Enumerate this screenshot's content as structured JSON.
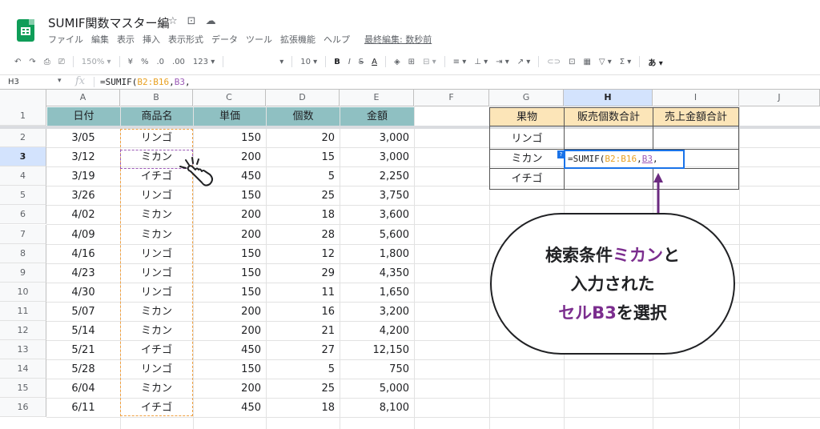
{
  "doc": {
    "title": "SUMIF関数マスター編",
    "icons": [
      "star-icon",
      "folder-move-icon",
      "cloud-status-icon"
    ],
    "menu": [
      "ファイル",
      "編集",
      "表示",
      "挿入",
      "表示形式",
      "データ",
      "ツール",
      "拡張機能",
      "ヘルプ"
    ],
    "last_edit": "最終編集: 数秒前"
  },
  "toolbar": {
    "zoom": "150%",
    "currency": "¥",
    "percent": "%",
    "dec_less": ".0",
    "dec_more": ".00",
    "format": "123",
    "font_size": "10",
    "input_tools": "あ"
  },
  "formula_bar": {
    "name_box": "H3",
    "fx": "fx",
    "formula": "=SUMIF(B2:B16,B3,"
  },
  "columns": [
    "A",
    "B",
    "C",
    "D",
    "E",
    "F",
    "G",
    "H",
    "I",
    "J"
  ],
  "selected_column": "H",
  "selected_row": "3",
  "rows": [
    "1",
    "2",
    "3",
    "4",
    "5",
    "6",
    "7",
    "8",
    "9",
    "10",
    "11",
    "12",
    "13",
    "14",
    "15",
    "16"
  ],
  "table": {
    "headers": [
      "日付",
      "商品名",
      "単価",
      "個数",
      "金額"
    ],
    "data": [
      [
        "3/05",
        "リンゴ",
        "150",
        "20",
        "3,000"
      ],
      [
        "3/12",
        "ミカン",
        "200",
        "15",
        "3,000"
      ],
      [
        "3/19",
        "イチゴ",
        "450",
        "5",
        "2,250"
      ],
      [
        "3/26",
        "リンゴ",
        "150",
        "25",
        "3,750"
      ],
      [
        "4/02",
        "ミカン",
        "200",
        "18",
        "3,600"
      ],
      [
        "4/09",
        "ミカン",
        "200",
        "28",
        "5,600"
      ],
      [
        "4/16",
        "リンゴ",
        "150",
        "12",
        "1,800"
      ],
      [
        "4/23",
        "リンゴ",
        "150",
        "29",
        "4,350"
      ],
      [
        "4/30",
        "リンゴ",
        "150",
        "11",
        "1,650"
      ],
      [
        "5/07",
        "ミカン",
        "200",
        "16",
        "3,200"
      ],
      [
        "5/14",
        "ミカン",
        "200",
        "21",
        "4,200"
      ],
      [
        "5/21",
        "イチゴ",
        "450",
        "27",
        "12,150"
      ],
      [
        "5/28",
        "リンゴ",
        "150",
        "5",
        "750"
      ],
      [
        "6/04",
        "ミカン",
        "200",
        "25",
        "5,000"
      ],
      [
        "6/11",
        "イチゴ",
        "450",
        "18",
        "8,100"
      ]
    ]
  },
  "summary": {
    "headers": [
      "果物",
      "販売個数合計",
      "売上金額合計"
    ],
    "fruits": [
      "リンゴ",
      "ミカン",
      "イチゴ"
    ]
  },
  "edit_cell": {
    "prefix": "=SUMIF(",
    "range": "B2:B16",
    "comma1": ",",
    "ref": "B3",
    "comma2": ","
  },
  "callout": {
    "line1_a": "検索条件",
    "line1_hl": "ミカン",
    "line1_b": "と",
    "line2": "入力された",
    "line3_hl": "セルB3",
    "line3_b": "を選択"
  },
  "colors": {
    "header_teal": "#8fc0c2",
    "header_peach": "#fce5b8",
    "range_orange": "#f0a040",
    "ref_purple": "#9b59b6",
    "edit_blue": "#1a73e8"
  }
}
